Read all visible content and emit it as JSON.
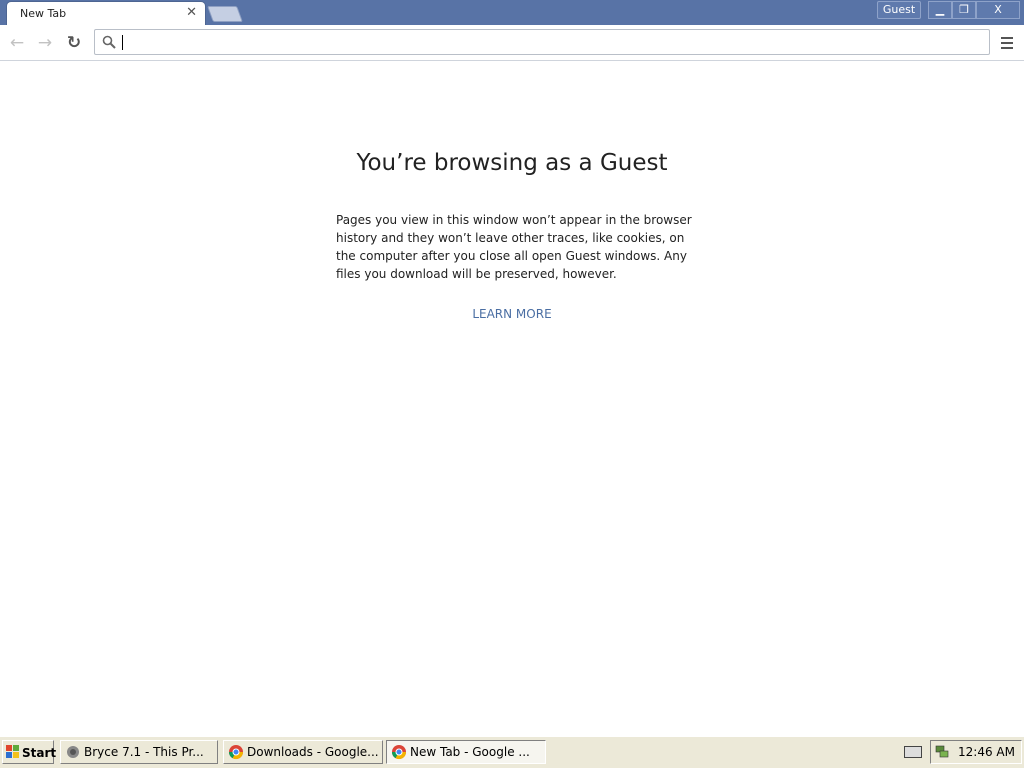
{
  "browser": {
    "tab": {
      "title": "New Tab",
      "close_glyph": "✕"
    },
    "profile_label": "Guest",
    "window_controls": {
      "minimize": "▁",
      "maximize": "❐",
      "close": "X"
    },
    "toolbar": {
      "back_icon": "←",
      "forward_icon": "→",
      "reload_icon": "↻"
    },
    "omnibox": {
      "value": "",
      "placeholder": ""
    }
  },
  "content": {
    "title": "You’re browsing as a Guest",
    "body": "Pages you view in this window won’t appear in the browser history and they won’t leave other traces, like cookies, on the computer after you close all open Guest windows. Any files you download will be preserved, however.",
    "learn_more": "LEARN MORE",
    "link_color": "#4a6ea3"
  },
  "taskbar": {
    "start_label": "Start",
    "tasks": [
      {
        "label": "Bryce 7.1 - This Pr..."
      },
      {
        "label": "Downloads - Google..."
      },
      {
        "label": "New Tab - Google ..."
      }
    ],
    "clock": "12:46 AM"
  },
  "colors": {
    "titlebar": "#5873a6",
    "taskbar": "#ece9d8"
  }
}
